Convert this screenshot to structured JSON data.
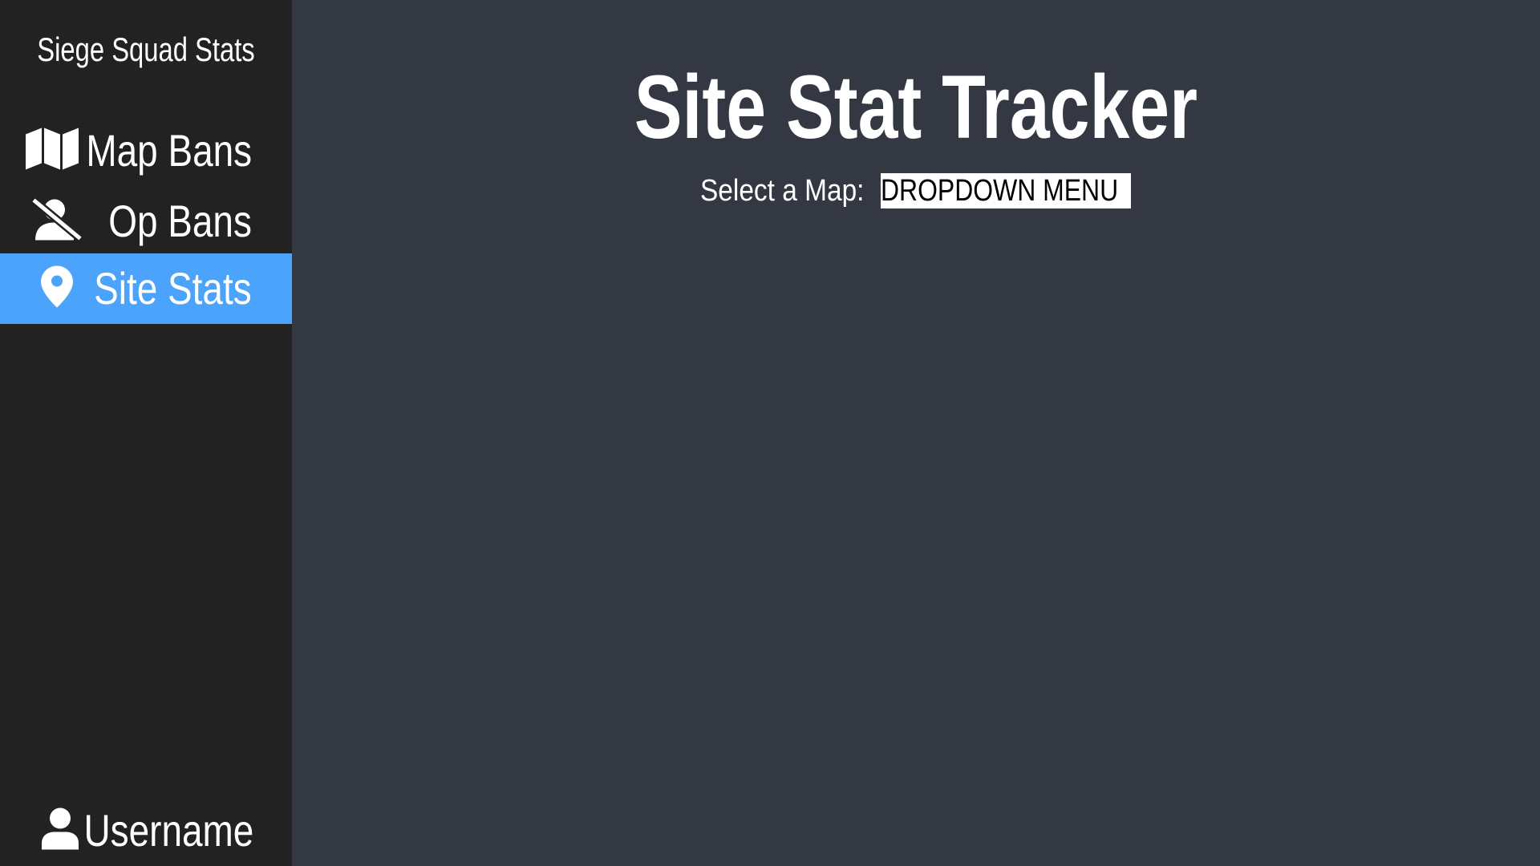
{
  "sidebar": {
    "brand": "Siege Squad Stats",
    "items": [
      {
        "label": "Map Bans",
        "icon": "map-icon",
        "active": false
      },
      {
        "label": "Op Bans",
        "icon": "user-slash-icon",
        "active": false
      },
      {
        "label": "Site Stats",
        "icon": "map-pin-icon",
        "active": true
      }
    ],
    "user": {
      "label": "Username",
      "icon": "user-icon"
    }
  },
  "main": {
    "title": "Site Stat Tracker",
    "select_label": "Select a Map:",
    "dropdown_value": "DROPDOWN MENU"
  },
  "colors": {
    "sidebar_bg": "#222222",
    "main_bg": "#343842",
    "accent": "#4ba3fb",
    "text": "#ffffff"
  }
}
